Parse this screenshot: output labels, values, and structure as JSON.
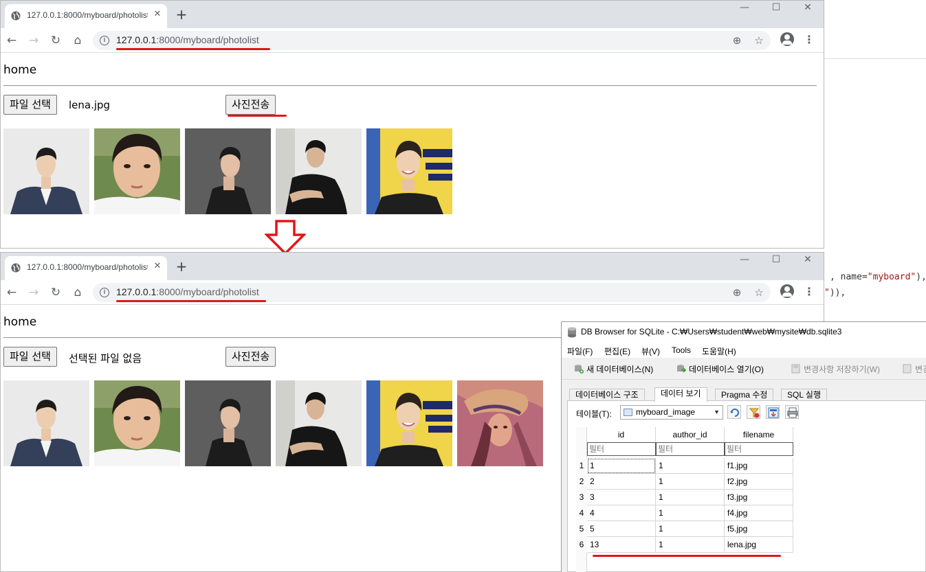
{
  "code_snippet": {
    "line1_prefix": ", name=",
    "line1_string": "\"myboard\"",
    "line1_suffix": "),",
    "line2_string": "\"",
    "line2_suffix": ")),"
  },
  "browser_top": {
    "tab_title": "127.0.0.1:8000/myboard/photolist",
    "url_host": "127.0.0.1",
    "url_path": ":8000/myboard/photolist",
    "page": {
      "home_link": "home",
      "file_button": "파일 선택",
      "file_name": "lena.jpg",
      "send_button": "사진전송"
    },
    "photos": [
      "f1.jpg",
      "f2.jpg",
      "f3.jpg",
      "f4.jpg",
      "f5.jpg"
    ]
  },
  "browser_bottom": {
    "tab_title": "127.0.0.1:8000/myboard/photolist",
    "url_host": "127.0.0.1",
    "url_path": ":8000/myboard/photolist",
    "page": {
      "home_link": "home",
      "file_button": "파일 선택",
      "file_name": "선택된 파일 없음",
      "send_button": "사진전송"
    },
    "photos": [
      "f1.jpg",
      "f2.jpg",
      "f3.jpg",
      "f4.jpg",
      "f5.jpg",
      "lena.jpg"
    ]
  },
  "db_browser": {
    "title": "DB Browser for SQLite - C:₩Users₩student₩web₩mysite₩db.sqlite3",
    "menus": [
      "파일(F)",
      "편집(E)",
      "뷰(V)",
      "Tools",
      "도움말(H)"
    ],
    "toolbar": {
      "new_db": "새 데이터베이스(N)",
      "open_db": "데이터베이스 열기(O)",
      "write_changes": "변경사항 저장하기(W)",
      "revert_changes": "변경"
    },
    "tabs": [
      "데이터베이스 구조",
      "데이터 보기",
      "Pragma 수정",
      "SQL 실행"
    ],
    "active_tab": "데이터 보기",
    "table_label": "테이블(T):",
    "table_selected": "myboard_image",
    "columns": [
      "id",
      "author_id",
      "filename"
    ],
    "filter_placeholder": "필터",
    "rows": [
      {
        "num": "1",
        "id": "1",
        "author_id": "1",
        "filename": "f1.jpg"
      },
      {
        "num": "2",
        "id": "2",
        "author_id": "1",
        "filename": "f2.jpg"
      },
      {
        "num": "3",
        "id": "3",
        "author_id": "1",
        "filename": "f3.jpg"
      },
      {
        "num": "4",
        "id": "4",
        "author_id": "1",
        "filename": "f4.jpg"
      },
      {
        "num": "5",
        "id": "5",
        "author_id": "1",
        "filename": "f5.jpg"
      },
      {
        "num": "6",
        "id": "13",
        "author_id": "1",
        "filename": "lena.jpg"
      }
    ]
  },
  "colors": {
    "annotation_red": "#e0161b",
    "chrome_tabstrip": "#dee1e6",
    "omnibox": "#f1f3f4"
  }
}
